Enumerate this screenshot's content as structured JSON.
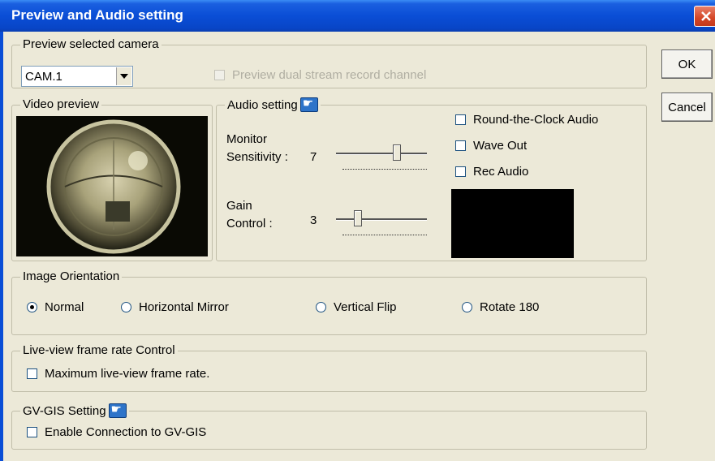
{
  "window": {
    "title": "Preview and Audio setting"
  },
  "buttons": {
    "ok": "OK",
    "cancel": "Cancel"
  },
  "preview_camera": {
    "group_title": "Preview selected camera",
    "selected_camera": "CAM.1",
    "dual_stream_label": "Preview dual stream record channel"
  },
  "video_preview": {
    "group_title": "Video preview"
  },
  "audio": {
    "group_title": "Audio setting",
    "monitor_label_1": "Monitor",
    "monitor_label_2": "Sensitivity :",
    "monitor_value": "7",
    "gain_label_1": "Gain",
    "gain_label_2": "Control :",
    "gain_value": "3",
    "round_clock_label": "Round-the-Clock Audio",
    "wave_out_label": "Wave Out",
    "rec_audio_label": "Rec Audio"
  },
  "orientation": {
    "group_title": "Image Orientation",
    "options": [
      "Normal",
      "Horizontal Mirror",
      "Vertical Flip",
      "Rotate 180"
    ],
    "selected": "Normal"
  },
  "frame_rate": {
    "group_title": "Live-view frame rate Control",
    "max_label": "Maximum live-view frame rate."
  },
  "gis": {
    "group_title": "GV-GIS Setting",
    "enable_label": "Enable Connection to GV-GIS"
  },
  "colors": {
    "titlebar": "#0a4ed6",
    "dialog_bg": "#ece9d8",
    "close_red": "#d44526"
  },
  "icons": [
    "close-icon",
    "dropdown-arrow-icon",
    "hand-pointer-icon"
  ]
}
